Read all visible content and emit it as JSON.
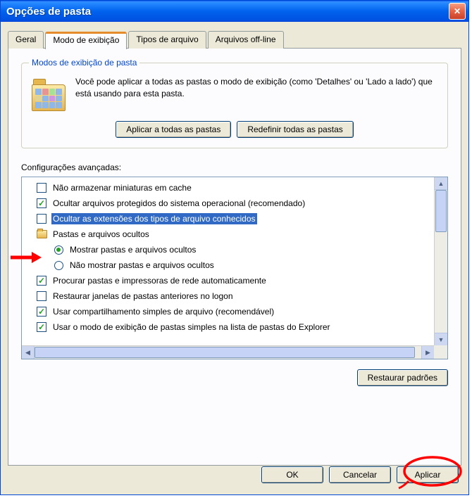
{
  "window": {
    "title": "Opções de pasta"
  },
  "tabs": {
    "items": [
      {
        "label": "Geral",
        "active": false
      },
      {
        "label": "Modo de exibição",
        "active": true
      },
      {
        "label": "Tipos de arquivo",
        "active": false
      },
      {
        "label": "Arquivos off-line",
        "active": false
      }
    ]
  },
  "groupbox": {
    "title": "Modos de exibição de pasta",
    "description": "Você pode aplicar a todas as pastas o modo de exibição (como 'Detalhes' ou 'Lado a lado') que está usando para esta pasta.",
    "apply_all_btn": "Aplicar a todas as pastas",
    "reset_all_btn": "Redefinir todas as pastas"
  },
  "advanced": {
    "label": "Configurações avançadas:",
    "items": [
      {
        "type": "check",
        "checked": false,
        "level": 0,
        "label": "Não armazenar miniaturas em cache"
      },
      {
        "type": "check",
        "checked": true,
        "level": 0,
        "label": "Ocultar arquivos protegidos do sistema operacional (recomendado)"
      },
      {
        "type": "check",
        "checked": false,
        "level": 0,
        "label": "Ocultar as extensões dos tipos de arquivo conhecidos",
        "selected": true
      },
      {
        "type": "folder",
        "level": 0,
        "label": "Pastas e arquivos ocultos"
      },
      {
        "type": "radio",
        "checked": true,
        "level": 1,
        "label": "Mostrar pastas e arquivos ocultos"
      },
      {
        "type": "radio",
        "checked": false,
        "level": 1,
        "label": "Não mostrar pastas e arquivos ocultos"
      },
      {
        "type": "check",
        "checked": true,
        "level": 0,
        "label": "Procurar pastas e impressoras de rede automaticamente"
      },
      {
        "type": "check",
        "checked": false,
        "level": 0,
        "label": "Restaurar janelas de pastas anteriores no logon"
      },
      {
        "type": "check",
        "checked": true,
        "level": 0,
        "label": "Usar compartilhamento simples de arquivo (recomendável)"
      },
      {
        "type": "check",
        "checked": true,
        "level": 0,
        "label": "Usar o modo de exibição de pastas simples na lista de pastas do Explorer"
      }
    ],
    "restore_defaults_btn": "Restaurar padrões"
  },
  "buttons": {
    "ok": "OK",
    "cancel": "Cancelar",
    "apply": "Aplicar"
  }
}
